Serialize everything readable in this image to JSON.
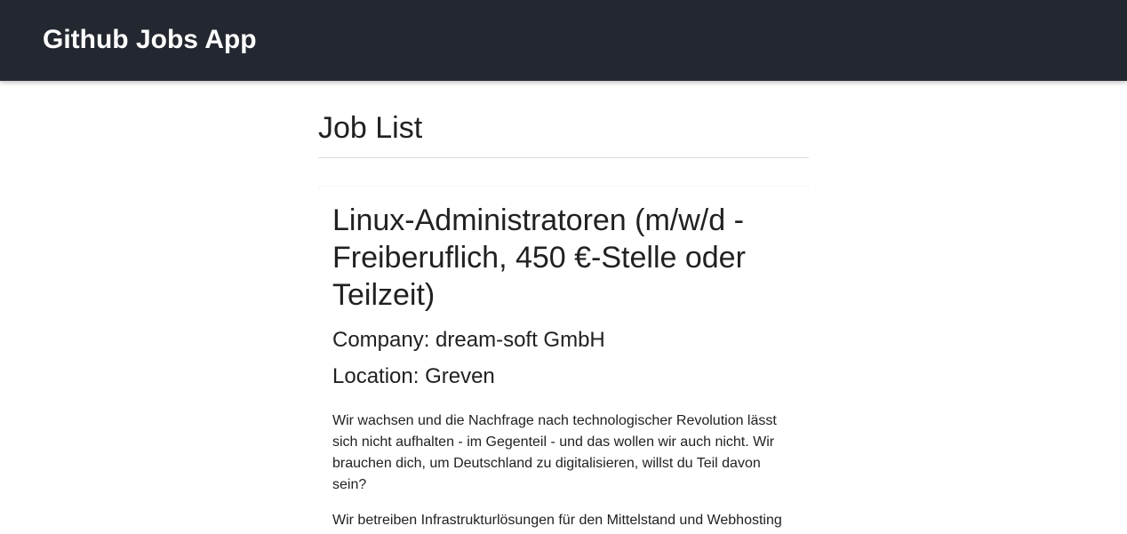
{
  "app_bar": {
    "title": "Github Jobs App",
    "background_color": "#232830"
  },
  "main": {
    "heading": "Job List",
    "jobs": [
      {
        "title": "Linux-Administratoren (m/w/d - Freiberuflich, 450 €-Stelle oder Teilzeit)",
        "company": "Company: dream-soft GmbH",
        "location": "Location: Greven",
        "description": [
          "Wir wachsen und die Nachfrage nach technologischer Revolution lässt sich nicht aufhalten - im Gegenteil - und das wollen wir auch nicht. Wir brauchen dich, um Deutschland zu digitalisieren, willst du Teil davon sein?",
          "Wir betreiben Infrastrukturlösungen für den Mittelstand und Webhosting"
        ]
      }
    ]
  }
}
